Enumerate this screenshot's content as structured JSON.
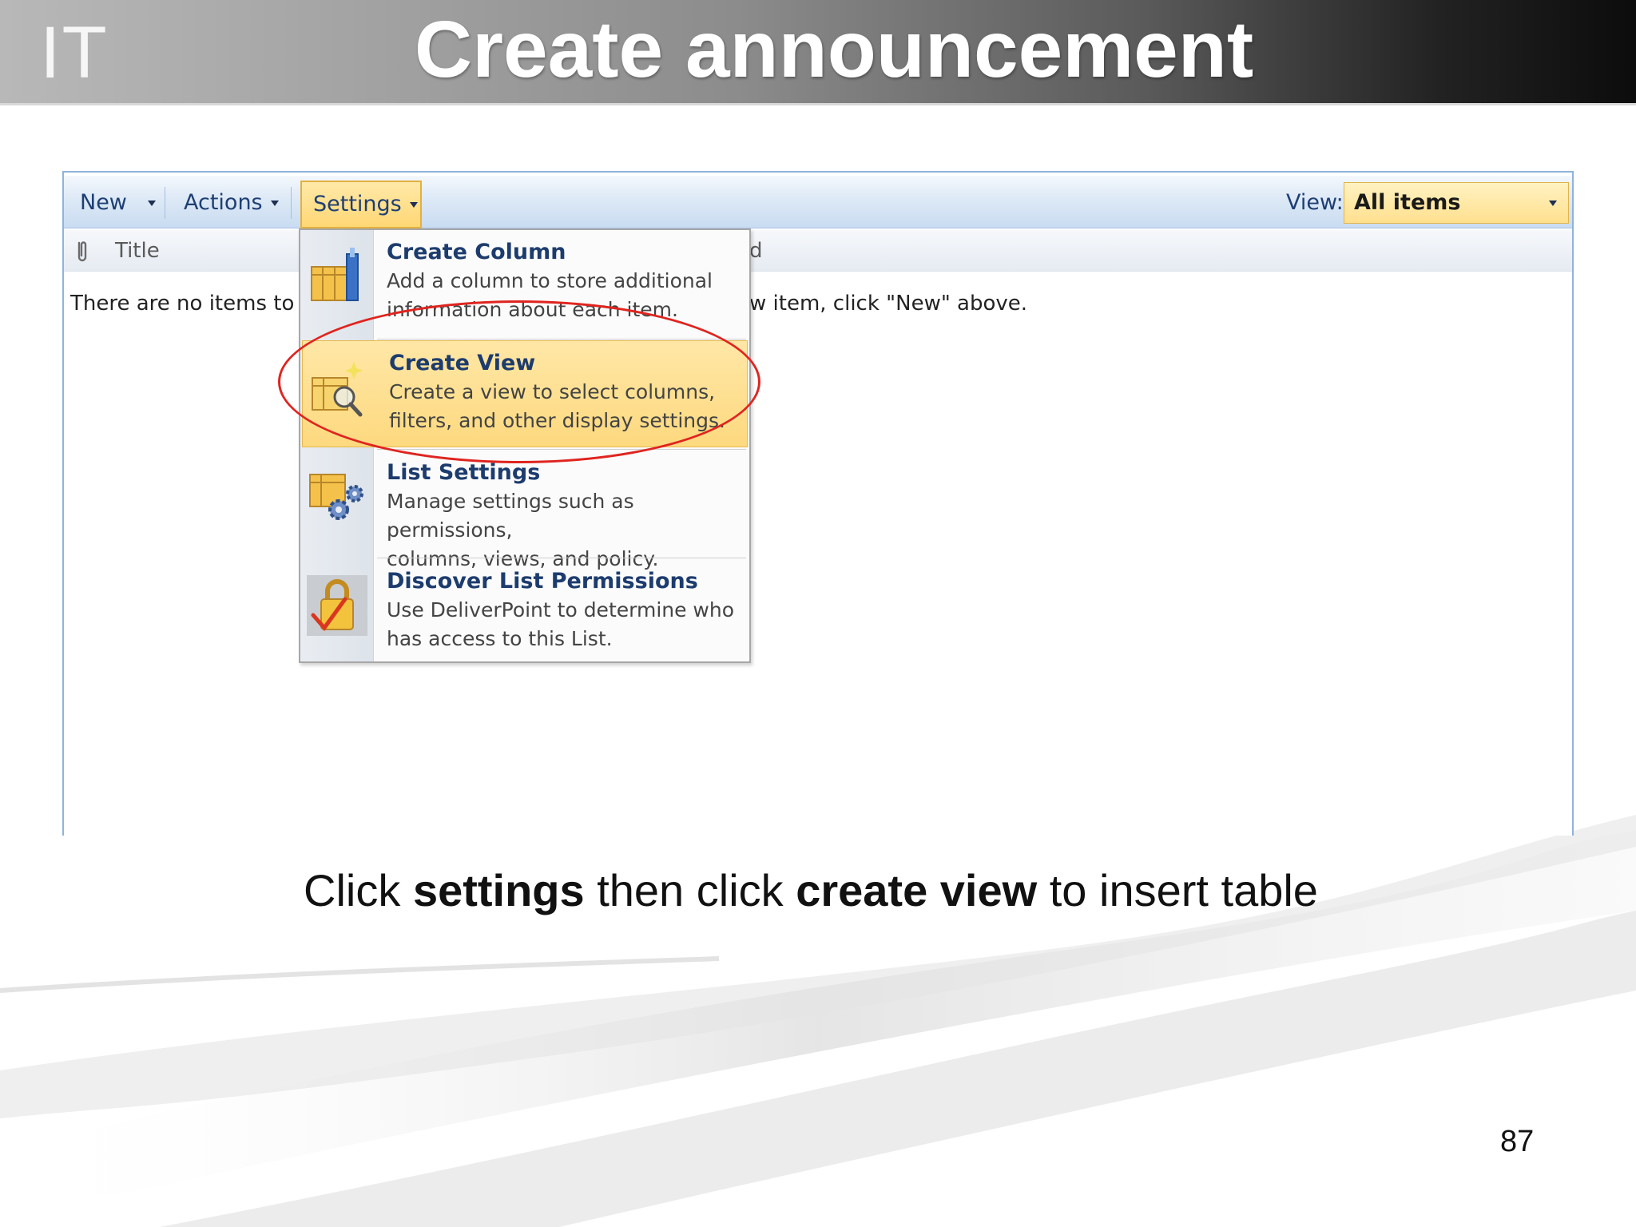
{
  "slide": {
    "logo": "IT",
    "title": "Create announcement",
    "page_number": "87"
  },
  "toolbar": {
    "new_label": "New",
    "actions_label": "Actions",
    "settings_label": "Settings",
    "view_label": "View:",
    "view_value": "All items"
  },
  "list": {
    "col_title": "Title",
    "col_fragment": "d",
    "empty_left": "There are no items to show",
    "empty_right": "w item, click \"New\" above."
  },
  "menu": {
    "items": [
      {
        "title": "Create Column",
        "desc1": "Add a column to store additional",
        "desc2": "information about each item.",
        "icon": "create-column-icon"
      },
      {
        "title": "Create View",
        "desc1": "Create a view to select columns,",
        "desc2": "filters, and other display settings.",
        "icon": "create-view-icon"
      },
      {
        "title": "List Settings",
        "desc1": "Manage settings such as permissions,",
        "desc2": "columns, views, and policy.",
        "icon": "list-settings-icon"
      },
      {
        "title": "Discover List Permissions",
        "desc1": "Use DeliverPoint to determine who",
        "desc2": "has access to this List.",
        "icon": "permissions-lock-icon"
      }
    ],
    "selected_index": 1
  },
  "caption": {
    "part1": "Click ",
    "bold1": "settings",
    "part2": " then click ",
    "bold2": "create view",
    "part3": " to insert table"
  },
  "colors": {
    "menu_highlight": "#fdd97f",
    "annotation_circle": "#e0241f",
    "link_blue": "#1d3c6e"
  }
}
